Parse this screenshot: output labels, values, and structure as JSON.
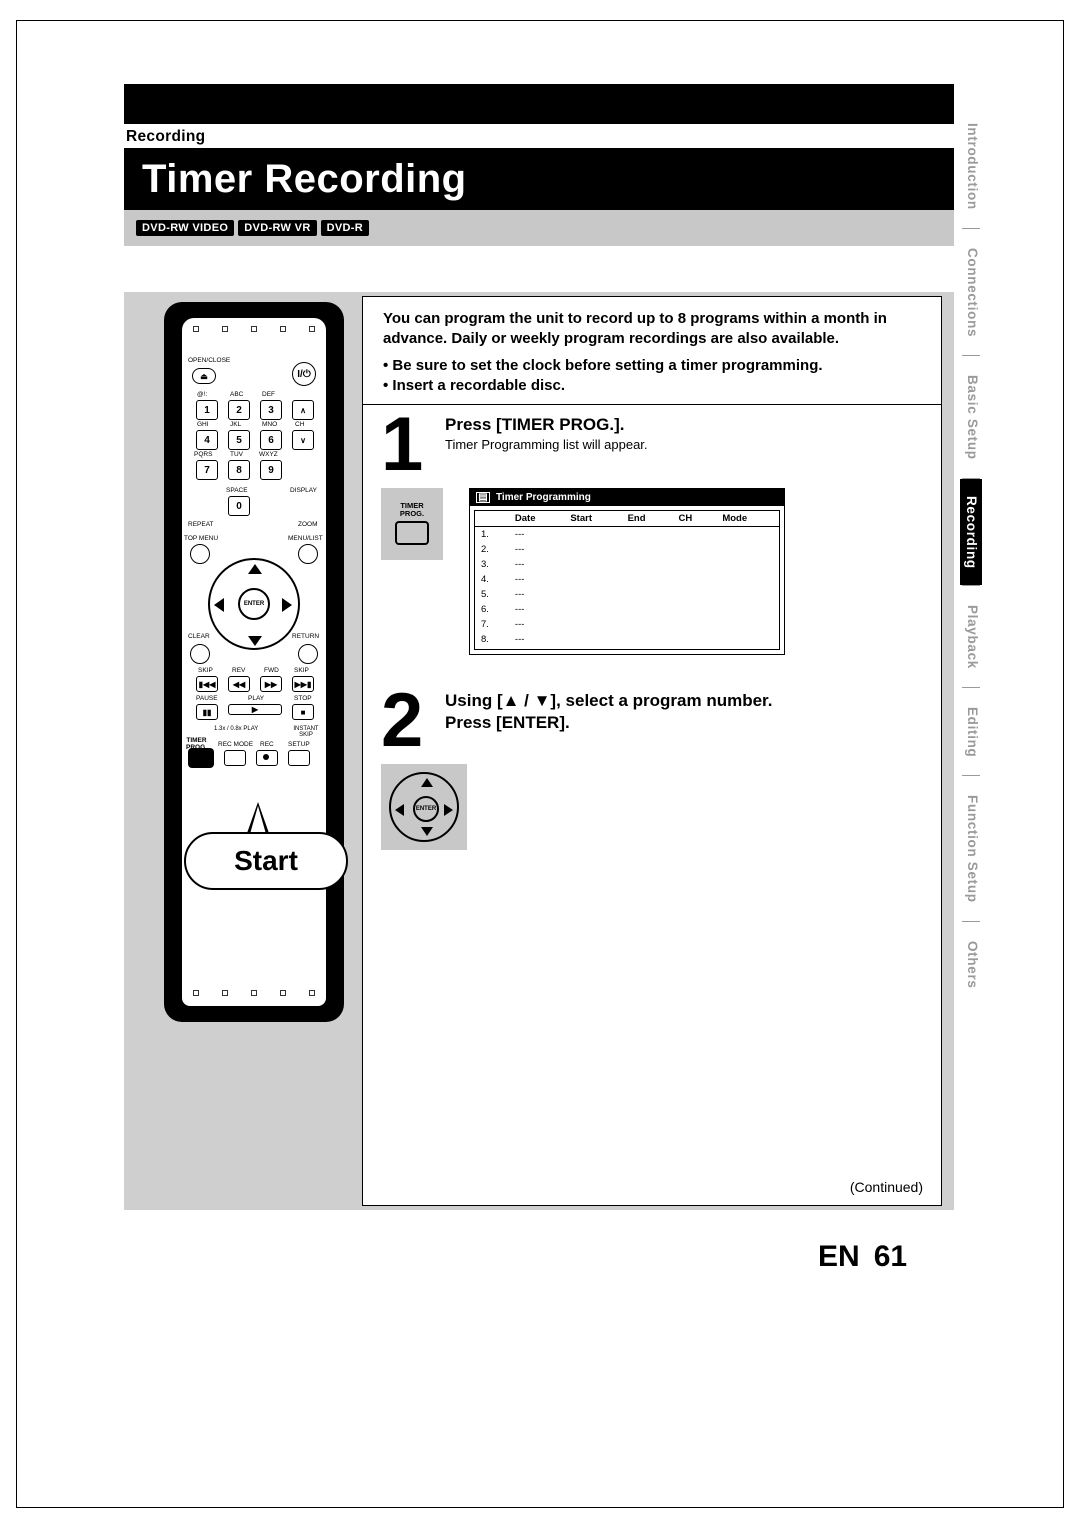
{
  "section_label": "Recording",
  "page_title": "Timer Recording",
  "disc_tags": [
    "DVD-RW VIDEO",
    "DVD-RW VR",
    "DVD-R"
  ],
  "intro": {
    "lead": "You can program the unit to record up to 8 programs within a month in advance. Daily or weekly program recordings are also available.",
    "bullets": [
      "Be sure to set the clock before setting a timer programming.",
      "Insert a recordable disc."
    ]
  },
  "steps": {
    "s1": {
      "num": "1",
      "title": "Press [TIMER PROG.].",
      "sub": "Timer Programming list will appear.",
      "button_label": "TIMER\nPROG.",
      "screen_title": "Timer Programming",
      "screen_cols": [
        "Date",
        "Start",
        "End",
        "CH",
        "Mode"
      ],
      "screen_rows": [
        "1.",
        "2.",
        "3.",
        "4.",
        "5.",
        "6.",
        "7.",
        "8."
      ],
      "screen_blank": "---"
    },
    "s2": {
      "num": "2",
      "title_a": "Using [▲ / ▼], select a program number.",
      "title_b": "Press [ENTER].",
      "enter_label": "ENTER"
    }
  },
  "remote": {
    "open_close": "OPEN/CLOSE",
    "open_close_icon": "⏏",
    "power_icon": "I/⏻",
    "keypad_letters": {
      "k1": "@!:",
      "k2": "ABC",
      "k3": "DEF",
      "k4": "GHI",
      "k5": "JKL",
      "k6": "MNO",
      "k7": "PQRS",
      "k8": "TUV",
      "k9": "WXYZ",
      "k0": "SPACE"
    },
    "ch_label": "CH",
    "display": "DISPLAY",
    "repeat": "REPEAT",
    "zoom": "ZOOM",
    "top_menu": "TOP MENU",
    "menu_list": "MENU/LIST",
    "enter": "ENTER",
    "clear": "CLEAR",
    "return": "RETURN",
    "transport": {
      "skip": "SKIP",
      "rev": "REV",
      "fwd": "FWD",
      "pause": "PAUSE",
      "play": "PLAY",
      "stop": "STOP"
    },
    "speed": "1.3x / 0.8x PLAY",
    "instant_skip": "INSTANT SKIP",
    "timer_prog": "TIMER\nPROG.",
    "rec_mode": "REC MODE",
    "rec": "REC",
    "setup": "SETUP",
    "start_bubble": "Start"
  },
  "side_tabs": {
    "t1": "Introduction",
    "t2": "Connections",
    "t3": "Basic Setup",
    "t4": "Recording",
    "t5": "Playback",
    "t6": "Editing",
    "t7": "Function Setup",
    "t8": "Others"
  },
  "continued": "(Continued)",
  "footer": {
    "lang": "EN",
    "page": "61"
  }
}
